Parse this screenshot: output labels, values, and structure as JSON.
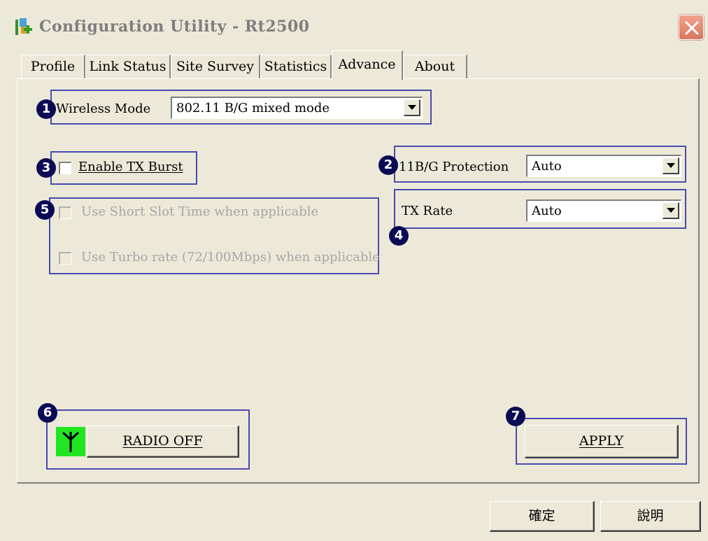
{
  "window": {
    "title": "Configuration Utility - Rt2500",
    "icon": "app-network-icon",
    "close_icon": "close-icon"
  },
  "tabs": [
    {
      "label": "Profile",
      "active": false
    },
    {
      "label": "Link Status",
      "active": false
    },
    {
      "label": "Site Survey",
      "active": false
    },
    {
      "label": "Statistics",
      "active": false
    },
    {
      "label": "Advance",
      "active": true
    },
    {
      "label": "About",
      "active": false
    }
  ],
  "advance": {
    "wireless_mode": {
      "badge": "1",
      "label": "Wireless Mode",
      "value": "802.11 B/G mixed mode"
    },
    "protection": {
      "badge": "2",
      "label": "11B/G Protection",
      "value": "Auto"
    },
    "tx_burst": {
      "badge": "3",
      "label": "Enable TX Burst",
      "checked": false
    },
    "tx_rate": {
      "badge": "4",
      "label": "TX Rate",
      "value": "Auto"
    },
    "options": {
      "badge": "5",
      "short_slot": {
        "label": "Use Short Slot Time when applicable",
        "checked": false,
        "enabled": false
      },
      "turbo_rate": {
        "label": "Use Turbo rate (72/100Mbps) when applicable",
        "checked": false,
        "enabled": false
      }
    },
    "radio": {
      "badge": "6",
      "button_label": "RADIO OFF",
      "icon": "antenna-icon",
      "indicator_color": "#22e522"
    },
    "apply": {
      "badge": "7",
      "button_label": "APPLY"
    }
  },
  "footer": {
    "ok_label": "確定",
    "help_label": "說明"
  },
  "colors": {
    "highlight_border": "#4a4ab0",
    "badge_fill": "#0b0b55",
    "dialog_bg": "#ece9d8"
  }
}
